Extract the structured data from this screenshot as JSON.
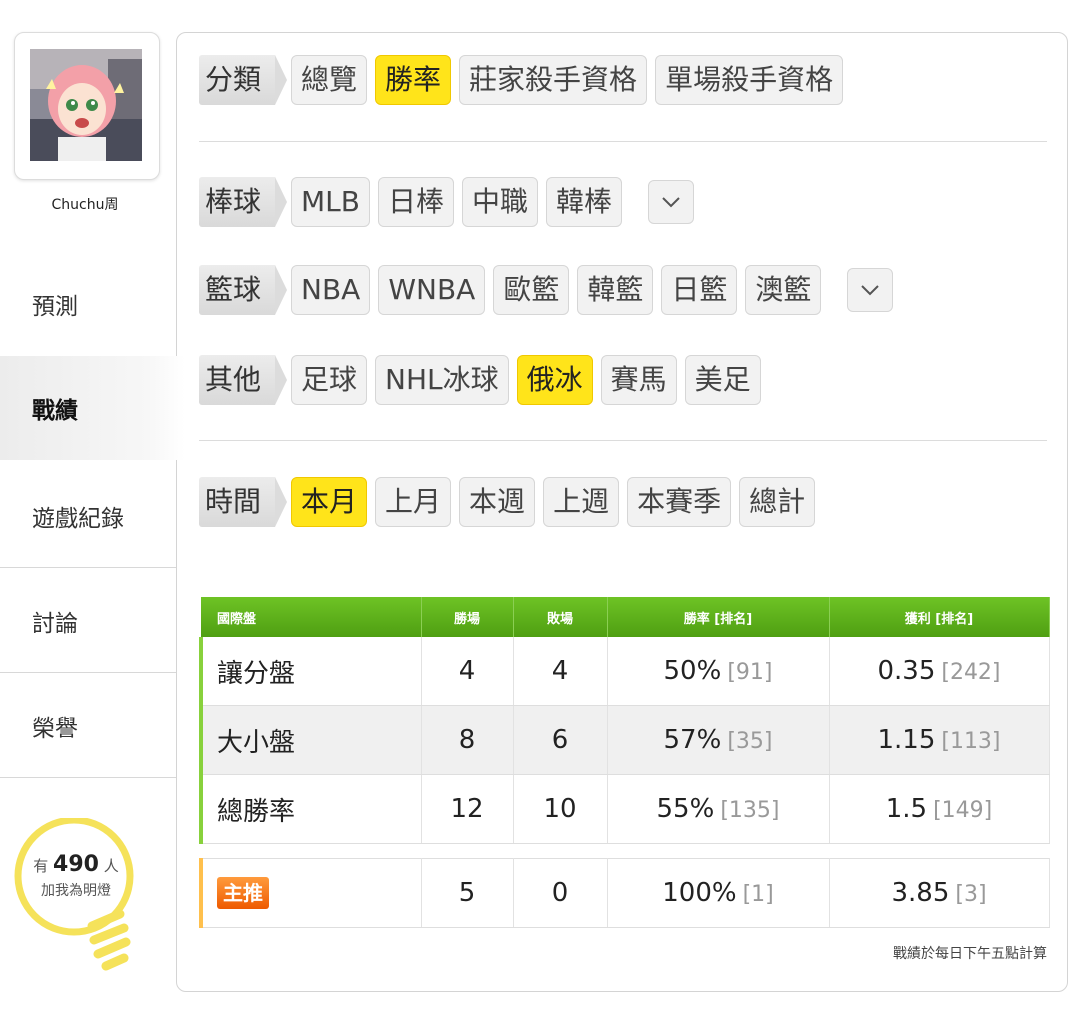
{
  "sidebar": {
    "username": "Chuchu周",
    "nav": [
      "預測",
      "戰績",
      "遊戲紀錄",
      "討論",
      "榮譽"
    ],
    "active_nav": "戰績",
    "lamp": {
      "prefix": "有",
      "count": "490",
      "suffix": "人",
      "caption": "加我為明燈"
    }
  },
  "filters": {
    "category": {
      "label": "分類",
      "options": [
        "總覽",
        "勝率",
        "莊家殺手資格",
        "單場殺手資格"
      ],
      "active": "勝率"
    },
    "baseball": {
      "label": "棒球",
      "options": [
        "MLB",
        "日棒",
        "中職",
        "韓棒"
      ]
    },
    "basketball": {
      "label": "籃球",
      "options": [
        "NBA",
        "WNBA",
        "歐籃",
        "韓籃",
        "日籃",
        "澳籃"
      ]
    },
    "other": {
      "label": "其他",
      "options": [
        "足球",
        "NHL冰球",
        "俄冰",
        "賽馬",
        "美足"
      ],
      "active": "俄冰"
    },
    "time": {
      "label": "時間",
      "options": [
        "本月",
        "上月",
        "本週",
        "上週",
        "本賽季",
        "總計"
      ],
      "active": "本月"
    }
  },
  "table": {
    "headers": [
      "國際盤",
      "勝場",
      "敗場",
      "勝率 [排名]",
      "獲利 [排名]"
    ],
    "rows": [
      {
        "name": "讓分盤",
        "win": "4",
        "loss": "4",
        "rate": "50%",
        "rate_rank": "[91]",
        "profit": "0.35",
        "profit_rank": "[242]"
      },
      {
        "name": "大小盤",
        "win": "8",
        "loss": "6",
        "rate": "57%",
        "rate_rank": "[35]",
        "profit": "1.15",
        "profit_rank": "[113]"
      },
      {
        "name": "總勝率",
        "win": "12",
        "loss": "10",
        "rate": "55%",
        "rate_rank": "[135]",
        "profit": "1.5",
        "profit_rank": "[149]"
      }
    ],
    "main_pick": {
      "badge": "主推",
      "win": "5",
      "loss": "0",
      "rate": "100%",
      "rate_rank": "[1]",
      "profit": "3.85",
      "profit_rank": "[3]"
    },
    "footnote": "戰績於每日下午五點計算"
  },
  "colors": {
    "highlight": "#ffe41a",
    "header_green": "#5cb21a",
    "badge_orange": "#f06a0a",
    "lamp_yellow": "#f5e25a"
  },
  "icons": {
    "dropdown": "chevron-down-icon",
    "lamp": "lightbulb-icon"
  }
}
